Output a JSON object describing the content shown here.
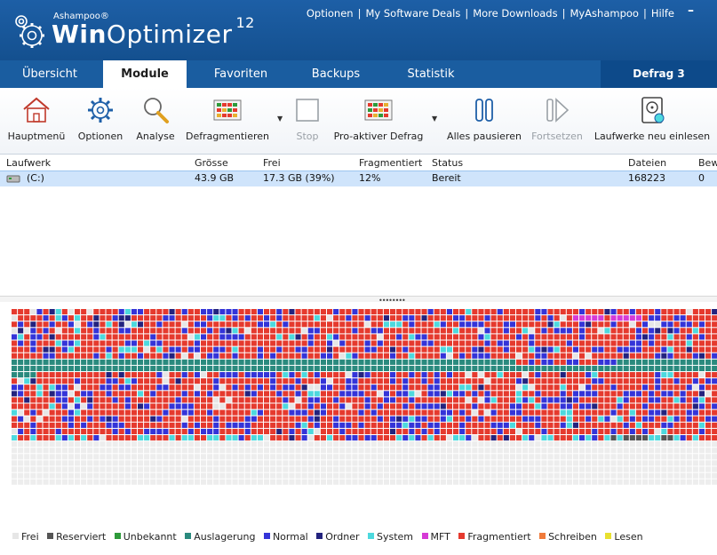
{
  "app": {
    "vendor": "Ashampoo®",
    "name_part1": "Win",
    "name_part2": "Optimizer",
    "version": "12",
    "minimize": "–"
  },
  "toplinks": [
    "Optionen",
    "My Software Deals",
    "More Downloads",
    "MyAshampoo",
    "Hilfe"
  ],
  "tabs": [
    {
      "label": "Übersicht",
      "active": false
    },
    {
      "label": "Module",
      "active": true
    },
    {
      "label": "Favoriten",
      "active": false
    },
    {
      "label": "Backups",
      "active": false
    },
    {
      "label": "Statistik",
      "active": false
    },
    {
      "label": "Defrag 3",
      "active": false
    }
  ],
  "toolbar": {
    "home": "Hauptmenü",
    "options": "Optionen",
    "analyze": "Analyse",
    "defrag": "Defragmentieren",
    "stop": "Stop",
    "proactive": "Pro-aktiver Defrag",
    "pause_all": "Alles pausieren",
    "resume": "Fortsetzen",
    "rescan": "Laufwerke neu einlesen"
  },
  "drives": {
    "headers": [
      "Laufwerk",
      "Grösse",
      "Frei",
      "Fragmentiert",
      "Status",
      "Dateien",
      "Bew"
    ],
    "rows": [
      {
        "drive": "(C:)",
        "size": "43.9 GB",
        "free": "17.3 GB (39%)",
        "fragmented": "12%",
        "status": "Bereit",
        "files": "168223",
        "moved": "0"
      }
    ]
  },
  "splitter_grip": "••••••••",
  "legend": [
    {
      "label": "Frei",
      "color": "#e6e6e6"
    },
    {
      "label": "Reserviert",
      "color": "#555555"
    },
    {
      "label": "Unbekannt",
      "color": "#2e9a3a"
    },
    {
      "label": "Auslagerung",
      "color": "#2a8a7e"
    },
    {
      "label": "Normal",
      "color": "#3434d8"
    },
    {
      "label": "Ordner",
      "color": "#23237e"
    },
    {
      "label": "System",
      "color": "#4dd9de"
    },
    {
      "label": "MFT",
      "color": "#d63ad6"
    },
    {
      "label": "Fragmentiert",
      "color": "#e53a2e"
    },
    {
      "label": "Schreiben",
      "color": "#f07a3a"
    },
    {
      "label": "Lesen",
      "color": "#e8e030"
    }
  ]
}
